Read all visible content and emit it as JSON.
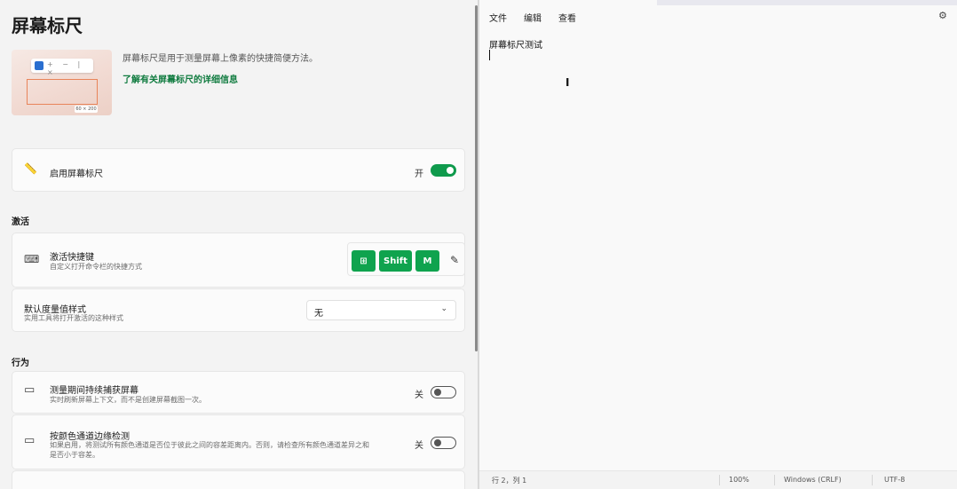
{
  "settings": {
    "title": "屏幕标尺",
    "hero": {
      "description": "屏幕标尺是用于测量屏幕上像素的快捷简便方法。",
      "link": "了解有关屏幕标尺的详细信息",
      "badge": "60 × 200"
    },
    "enable": {
      "label": "启用屏幕标尺",
      "state": "开"
    },
    "activation": {
      "section": "激活",
      "shortcut": {
        "title": "激活快捷键",
        "subtitle": "自定义打开命令栏的快捷方式",
        "keys": [
          "⊞",
          "Shift",
          "M"
        ]
      },
      "default_style": {
        "title": "默认度量值样式",
        "subtitle": "实用工具将打开激活的这种样式",
        "value": "无"
      }
    },
    "behavior": {
      "section": "行为",
      "continuous": {
        "title": "测量期间持续捕获屏幕",
        "subtitle": "实时刷新屏幕上下文，而不是创建屏幕截图一次。",
        "state": "关"
      },
      "per_channel": {
        "title": "按颜色通道边缘检测",
        "subtitle_1": "如果启用，将测试所有颜色通道是否位于彼此之间的容差距离内。否则，请检查所有颜色通道差异之和",
        "subtitle_2": "是否小于容差。",
        "state": "关"
      }
    }
  },
  "notepad": {
    "menu": [
      "文件",
      "编辑",
      "查看"
    ],
    "content": "屏幕标尺测试",
    "status": {
      "position": "行 2，列 1",
      "zoom": "100%",
      "line_ending": "Windows (CRLF)",
      "encoding": "UTF-8"
    }
  },
  "colors": {
    "accent": "#0f9a4c",
    "link": "#0f7b3f"
  }
}
